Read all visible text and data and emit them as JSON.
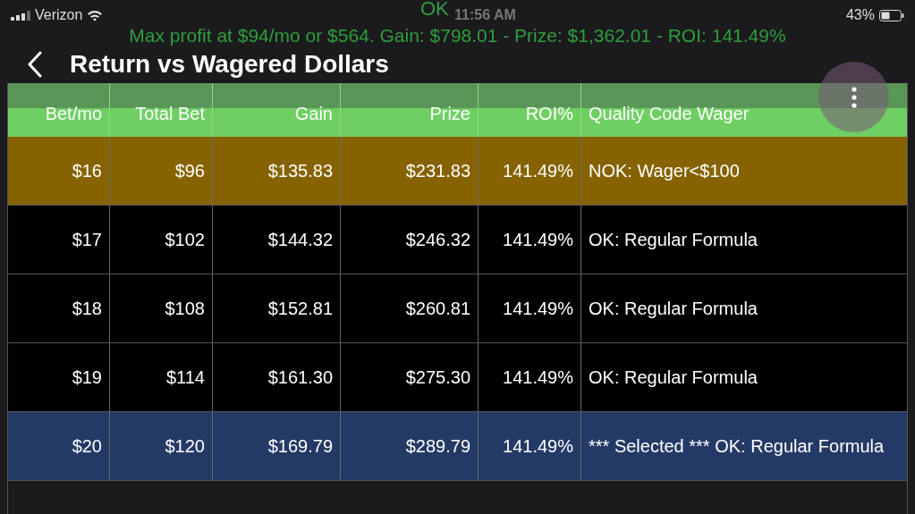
{
  "status_bar": {
    "carrier": "Verizon",
    "time": "11:56 AM",
    "battery": "43%"
  },
  "toast": "OK",
  "summary": "Max profit at $94/mo or $564. Gain: $798.01 - Prize: $1,362.01 - ROI: 141.49%",
  "nav": {
    "title": "Return vs Wagered Dollars"
  },
  "table": {
    "columns": [
      "Bet/mo",
      "Total Bet",
      "Gain",
      "Prize",
      "ROI%",
      "Quality Code Wager"
    ],
    "rows": [
      {
        "kind": "nok",
        "selected": false,
        "cells": [
          "$16",
          "$96",
          "$135.83",
          "$231.83",
          "141.49%",
          "NOK: Wager<$100"
        ]
      },
      {
        "kind": "ok",
        "selected": false,
        "cells": [
          "$17",
          "$102",
          "$144.32",
          "$246.32",
          "141.49%",
          "OK: Regular Formula"
        ]
      },
      {
        "kind": "ok",
        "selected": false,
        "cells": [
          "$18",
          "$108",
          "$152.81",
          "$260.81",
          "141.49%",
          "OK: Regular Formula"
        ]
      },
      {
        "kind": "ok",
        "selected": false,
        "cells": [
          "$19",
          "$114",
          "$161.30",
          "$275.30",
          "141.49%",
          "OK: Regular Formula"
        ]
      },
      {
        "kind": "ok",
        "selected": true,
        "cells": [
          "$20",
          "$120",
          "$169.79",
          "$289.79",
          "141.49%",
          "*** Selected *** OK: Regular Formula"
        ]
      }
    ]
  }
}
